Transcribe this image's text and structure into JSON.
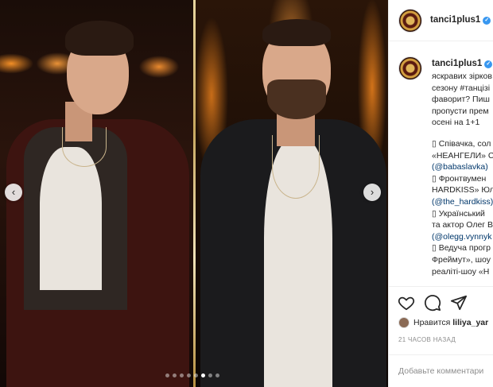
{
  "post": {
    "username": "tanci1plus1",
    "verified_mark": "✓",
    "caption_lines": [
      {
        "text": "яскравих зірков",
        "kind": "text"
      },
      {
        "text": "сезону #танцізі",
        "kind": "mixed"
      },
      {
        "text": "фаворит? Пиш",
        "kind": "text"
      },
      {
        "text": "пропусти прем",
        "kind": "text"
      },
      {
        "text": "осені на 1+1",
        "kind": "text"
      },
      {
        "text": "",
        "kind": "gap"
      },
      {
        "text": "▯ Співачка, сол",
        "kind": "text"
      },
      {
        "text": "«НЕАНГЕЛИ» С",
        "kind": "text"
      },
      {
        "text": "(@babaslavka)",
        "kind": "link"
      },
      {
        "text": "▯ Фронтвумен",
        "kind": "text"
      },
      {
        "text": "HARDKISS» Юл",
        "kind": "text"
      },
      {
        "text": "(@the_hardkiss)",
        "kind": "link"
      },
      {
        "text": "▯ Український",
        "kind": "text"
      },
      {
        "text": "та актор Олег В",
        "kind": "text"
      },
      {
        "text": "(@olegg.vynnyk",
        "kind": "link"
      },
      {
        "text": "▯ Ведуча прогр",
        "kind": "text"
      },
      {
        "text": "Фреймут», шоу",
        "kind": "text"
      },
      {
        "text": "реаліті-шоу «Н",
        "kind": "text"
      }
    ],
    "liked_by_prefix": "Нравится",
    "liked_by_user": "liliya_yar",
    "timestamp": "21 ЧАСОВ НАЗАД",
    "comment_placeholder": "Добавьте комментари"
  },
  "carousel": {
    "prev_icon": "‹",
    "next_icon": "›",
    "total_slides": 8,
    "active_slide": 6
  },
  "icons": [
    "heart-icon",
    "comment-icon",
    "share-icon",
    "chevron-left-icon",
    "chevron-right-icon",
    "verified-badge-icon"
  ],
  "colors": {
    "link": "#00376b",
    "verified": "#3897f0",
    "muted": "#8e8e8e"
  }
}
